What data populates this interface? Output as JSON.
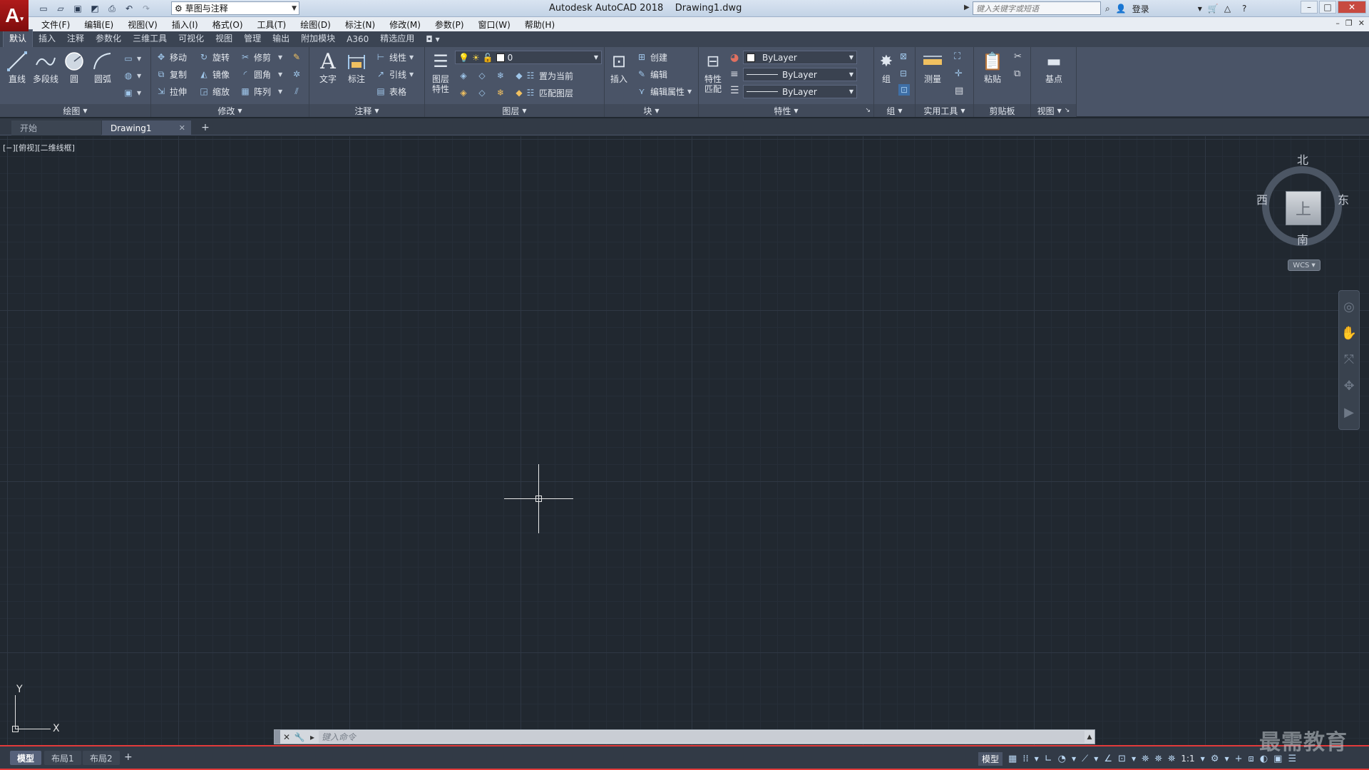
{
  "app": {
    "logo_letter": "A",
    "workspace": "草图与注释",
    "window_title": "Autodesk AutoCAD 2018    Drawing1.dwg",
    "search_placeholder": "键入关键字或短语",
    "login_label": "登录"
  },
  "menubar": [
    "文件(F)",
    "编辑(E)",
    "视图(V)",
    "插入(I)",
    "格式(O)",
    "工具(T)",
    "绘图(D)",
    "标注(N)",
    "修改(M)",
    "参数(P)",
    "窗口(W)",
    "帮助(H)"
  ],
  "ribbon_tabs": [
    "默认",
    "插入",
    "注释",
    "参数化",
    "三维工具",
    "可视化",
    "视图",
    "管理",
    "输出",
    "附加模块",
    "A360",
    "精选应用"
  ],
  "ribbon": {
    "draw": {
      "title": "绘图",
      "line": "直线",
      "polyline": "多段线",
      "circle": "圆",
      "arc": "圆弧"
    },
    "modify": {
      "title": "修改",
      "move": "移动",
      "rotate": "旋转",
      "trim": "修剪",
      "copy": "复制",
      "mirror": "镜像",
      "fillet": "圆角",
      "stretch": "拉伸",
      "scale": "缩放",
      "array": "阵列"
    },
    "annotation": {
      "title": "注释",
      "text": "文字",
      "dimension": "标注",
      "linear": "线性",
      "leader": "引线",
      "table": "表格"
    },
    "layers": {
      "title": "图层",
      "layer_props_1": "图层",
      "layer_props_2": "特性",
      "current_layer": "0",
      "set_current": "置为当前",
      "match_layer": "匹配图层"
    },
    "block": {
      "title": "块",
      "insert": "插入",
      "create": "创建",
      "edit": "编辑",
      "edit_attributes": "编辑属性"
    },
    "properties": {
      "title": "特性",
      "match_1": "特性",
      "match_2": "匹配",
      "color": "ByLayer",
      "linetype": "ByLayer",
      "lineweight": "ByLayer"
    },
    "groups": {
      "title": "组",
      "group": "组"
    },
    "utilities": {
      "title": "实用工具",
      "measure": "测量"
    },
    "clipboard": {
      "title": "剪贴板",
      "paste": "粘贴"
    },
    "view": {
      "title": "视图",
      "base": "基点"
    }
  },
  "file_tabs": {
    "start": "开始",
    "drawing": "Drawing1"
  },
  "canvas": {
    "viewport_label": "[−][俯视][二维线框]",
    "viewcube": {
      "north": "北",
      "south": "南",
      "west": "西",
      "east": "东",
      "face": "上",
      "wcs": "WCS"
    },
    "ucs_x": "X",
    "ucs_y": "Y"
  },
  "command_line": {
    "placeholder": "键入命令"
  },
  "status_bar": {
    "layout_tabs": [
      "模型",
      "布局1",
      "布局2"
    ],
    "model_label": "模型",
    "scale": "1:1"
  },
  "watermark": "最需教育",
  "colors": {
    "canvas_bg": "#212830",
    "ribbon_bg": "#4a5467",
    "status_highlight": "#e23a3a"
  }
}
